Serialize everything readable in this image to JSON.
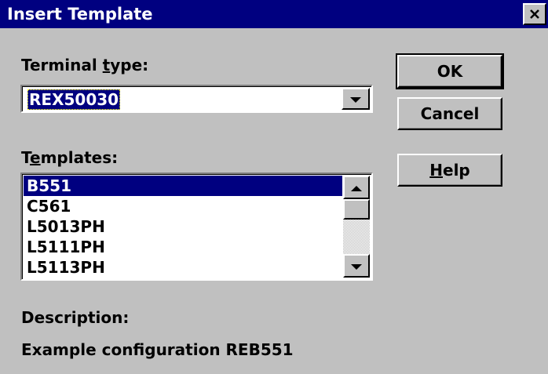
{
  "window": {
    "title": "Insert Template",
    "close_glyph": "close-icon"
  },
  "terminal_type": {
    "label_prefix": "Terminal ",
    "label_accel": "t",
    "label_suffix": "ype:",
    "value": "REX50030"
  },
  "templates": {
    "label_prefix": "T",
    "label_accel": "e",
    "label_suffix": "mplates:",
    "items": [
      "B551",
      "C561",
      "L5013PH",
      "L5111PH",
      "L5113PH"
    ],
    "selected_index": 0
  },
  "buttons": {
    "ok": "OK",
    "cancel": "Cancel",
    "help_accel": "H",
    "help_suffix": "elp"
  },
  "description": {
    "label": "Description:",
    "text": "Example configuration REB551"
  },
  "colors": {
    "titlebar": "#000080",
    "face": "#c0c0c0",
    "selection": "#000080"
  }
}
